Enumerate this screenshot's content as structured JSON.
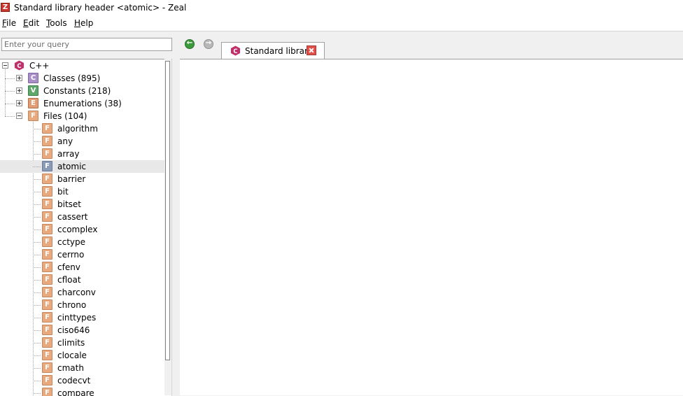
{
  "window": {
    "title": "Standard library header <atomic> - Zeal",
    "icon": "zeal-app-icon"
  },
  "menu": [
    {
      "key": "F",
      "rest": "ile"
    },
    {
      "key": "E",
      "rest": "dit"
    },
    {
      "key": "T",
      "rest": "ools"
    },
    {
      "key": "H",
      "rest": "elp"
    }
  ],
  "search": {
    "placeholder": "Enter your query",
    "value": ""
  },
  "tree": {
    "root": {
      "label": "C++",
      "icon": "cpp-docset-icon"
    },
    "groups": [
      {
        "badge": "C",
        "label": "Classes (895)",
        "expanded": false
      },
      {
        "badge": "V",
        "label": "Constants (218)",
        "expanded": false
      },
      {
        "badge": "E",
        "label": "Enumerations (38)",
        "expanded": false
      },
      {
        "badge": "F",
        "label": "Files (104)",
        "expanded": true
      }
    ],
    "files": [
      "algorithm",
      "any",
      "array",
      "atomic",
      "barrier",
      "bit",
      "bitset",
      "cassert",
      "ccomplex",
      "cctype",
      "cerrno",
      "cfenv",
      "cfloat",
      "charconv",
      "chrono",
      "cinttypes",
      "ciso646",
      "climits",
      "clocale",
      "cmath",
      "codecvt",
      "compare"
    ],
    "file_badge": "F",
    "selected": "atomic"
  },
  "tab": {
    "label": "Standard librar...",
    "icon": "cpp-docset-icon",
    "close_icon": "close-icon"
  },
  "nav": {
    "back_icon": "back-arrow-icon",
    "forward_icon": "forward-arrow-icon"
  },
  "colors": {
    "selected_row": "#e8e8e8",
    "close_button": "#e2504a",
    "back_button": "#3c9a3c"
  }
}
